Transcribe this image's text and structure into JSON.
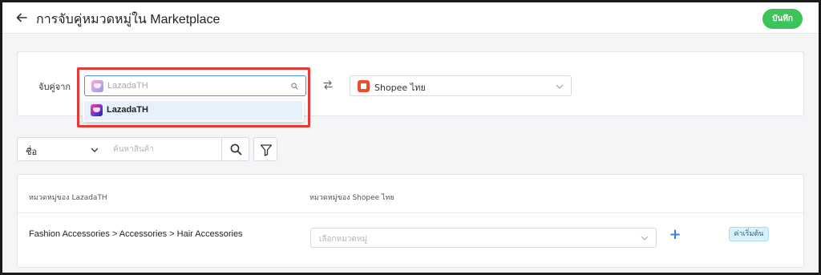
{
  "header": {
    "title": "การจับคู่หมวดหมู่ใน Marketplace",
    "save_label": "บันทึก"
  },
  "mapping": {
    "label": "จับคู่จาก",
    "source": {
      "value": "LazadaTH",
      "icon": "lazada-logo"
    },
    "dropdown": {
      "options": [
        {
          "label": "LazadaTH",
          "icon": "lazada-logo"
        }
      ]
    },
    "swap_icon": "swap-arrows-icon",
    "target": {
      "value": "Shopee ไทย",
      "icon": "shopee-logo"
    },
    "highlight_color": "#e53935"
  },
  "filter": {
    "field_value": "ชื่อ",
    "search_placeholder": "ค้นหาสินค้า"
  },
  "table": {
    "columns": [
      "หมวดหมู่ของ LazadaTH",
      "หมวดหมู่ของ Shopee ไทย"
    ],
    "rows": [
      {
        "source_path": "Fashion Accessories > Accessories > Hair Accessories",
        "target_placeholder": "เลือกหมวดหมู่",
        "add_label": "+",
        "badge": "ค่าเริ่มต้น"
      }
    ]
  },
  "colors": {
    "save_button": "#3cc35a",
    "focus_border": "#4a90e2",
    "selected_option": "#e7f1fb",
    "add_button": "#2f80ed",
    "badge_bg": "#d8f1fb"
  }
}
